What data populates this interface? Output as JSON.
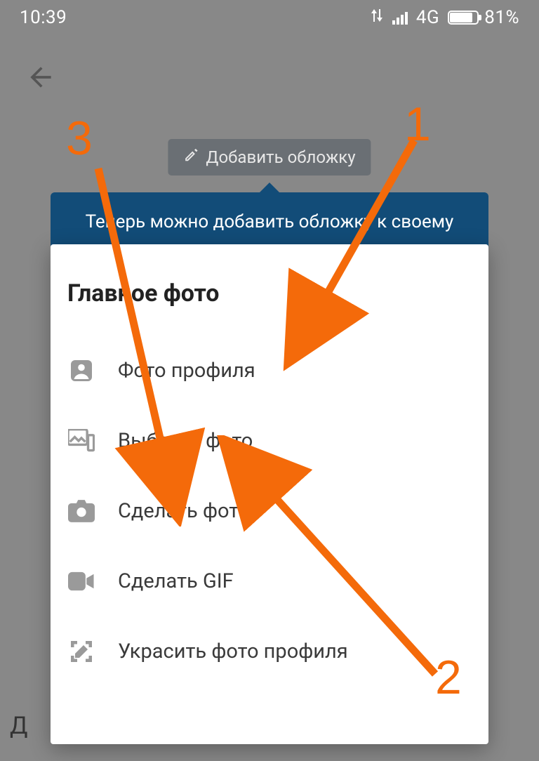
{
  "status": {
    "time": "10:39",
    "network": "4G",
    "battery_pct": "81%"
  },
  "add_cover_btn": "Добавить обложку",
  "tooltip": "Теперь можно добавить обложку к своему",
  "sheet": {
    "title": "Главное фото",
    "items": [
      {
        "label": "Фото профиля",
        "icon": "person-square-icon"
      },
      {
        "label": "Выбрать фото",
        "icon": "gallery-icon"
      },
      {
        "label": "Сделать фото",
        "icon": "camera-icon"
      },
      {
        "label": "Сделать GIF",
        "icon": "video-camera-icon"
      },
      {
        "label": "Украсить фото профиля",
        "icon": "decorate-icon"
      }
    ]
  },
  "bottom_letter": "Д",
  "annotations": {
    "n1": "1",
    "n2": "2",
    "n3": "3"
  }
}
